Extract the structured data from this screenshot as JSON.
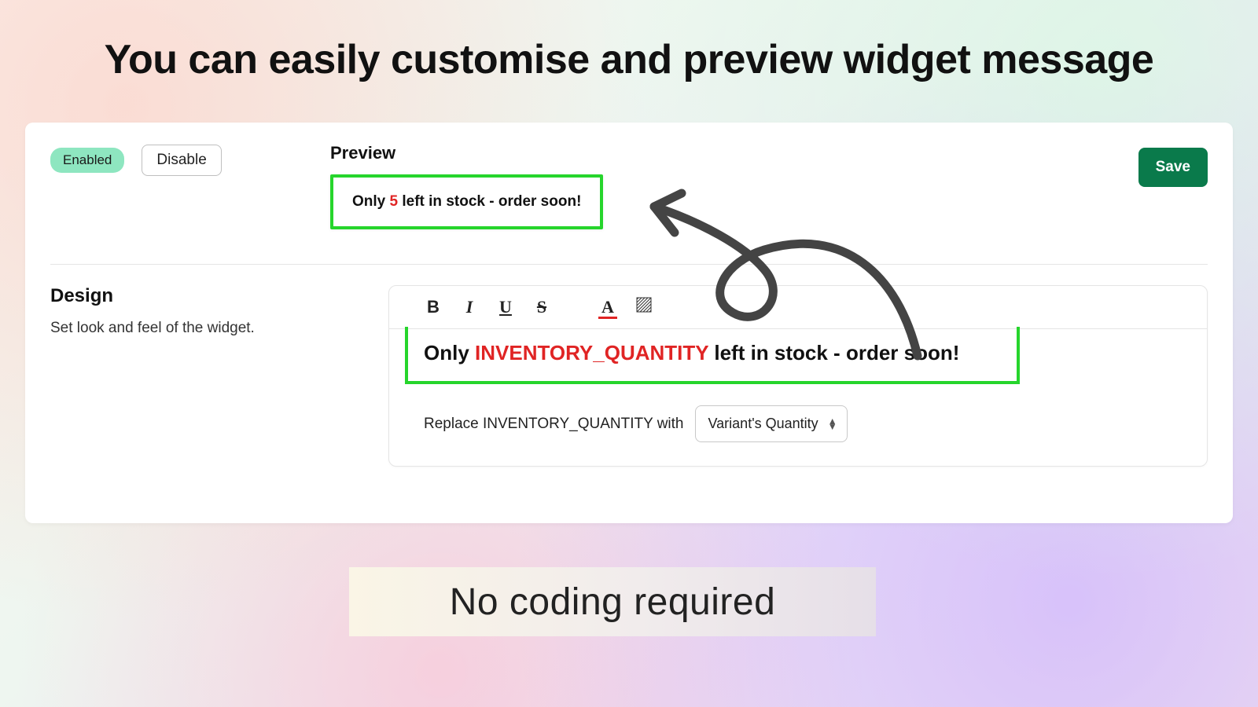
{
  "hero": {
    "title": "You can easily customise and preview widget message"
  },
  "panel": {
    "status": {
      "enabled_label": "Enabled",
      "disable_label": "Disable"
    },
    "preview": {
      "heading": "Preview",
      "prefix": "Only ",
      "qty": "5",
      "suffix": " left in stock - order soon!"
    },
    "save_label": "Save",
    "design": {
      "heading": "Design",
      "desc": "Set look and feel of the widget."
    },
    "editor": {
      "prefix": "Only ",
      "token": "INVENTORY_QUANTITY",
      "suffix": " left in stock - order soon!"
    },
    "replace": {
      "label": "Replace INVENTORY_QUANTITY with",
      "selected": "Variant's Quantity"
    },
    "toolbar": {
      "bold": "B",
      "italic": "I",
      "underline": "U",
      "strike": "S",
      "color": "A"
    }
  },
  "footer": {
    "text": "No coding required"
  }
}
